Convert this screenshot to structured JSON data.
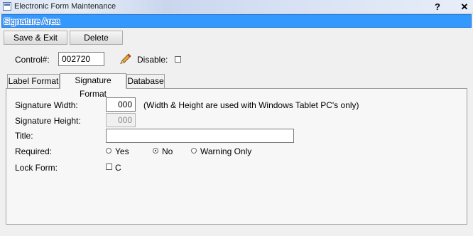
{
  "window": {
    "title": "Electronic Form Maintenance",
    "help_label": "?",
    "close_label": "✕"
  },
  "banner": {
    "text": "Signature Area"
  },
  "toolbar": {
    "save_label": "Save & Exit",
    "delete_label": "Delete"
  },
  "control": {
    "label": "Control#:",
    "value": "002720",
    "disable_label": "Disable:"
  },
  "tabs": [
    {
      "label": "Label Format",
      "active": false
    },
    {
      "label": "Signature Format",
      "active": true
    },
    {
      "label": "Database",
      "active": false
    }
  ],
  "signature_format": {
    "width_label": "Signature Width:",
    "width_value": "000",
    "width_note": "(Width & Height are used with Windows Tablet PC's only)",
    "height_label": "Signature Height:",
    "height_value": "000",
    "title_label": "Title:",
    "title_value": "",
    "required_label": "Required:",
    "required_options": [
      "Yes",
      "No",
      "Warning Only"
    ],
    "required_selected": "No",
    "lock_label": "Lock Form:",
    "lock_checkbox_text": "C"
  }
}
